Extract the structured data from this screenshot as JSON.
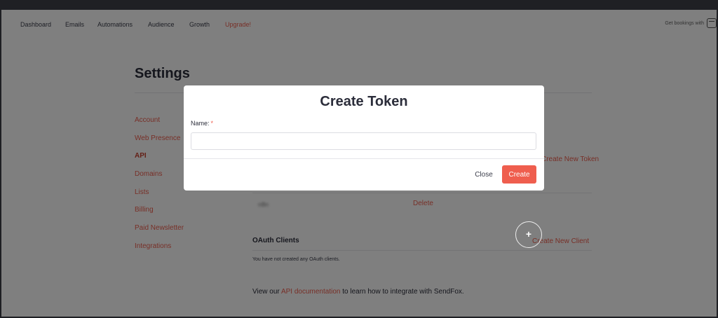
{
  "nav": {
    "items": [
      "Dashboard",
      "Emails",
      "Automations",
      "Audience",
      "Growth"
    ],
    "upgrade": "Upgrade!",
    "bookings": "Get bookings with"
  },
  "page": {
    "title": "Settings"
  },
  "sidebar": {
    "items": [
      "Account",
      "Web Presence",
      "API",
      "Domains",
      "Lists",
      "Billing",
      "Paid Newsletter",
      "Integrations"
    ],
    "active": "API"
  },
  "api": {
    "create_token_link": "Create New Token",
    "token_name": "n8n",
    "delete_link": "Delete",
    "oauth_title": "OAuth Clients",
    "create_client_link": "Create New Client",
    "oauth_empty": "You have not created any OAuth clients.",
    "note_prefix": "View our ",
    "note_link": "API documentation",
    "note_suffix": " to learn how to integrate with SendFox."
  },
  "modal": {
    "title": "Create Token",
    "name_label": "Name:",
    "required_mark": "*",
    "name_value": "",
    "close_label": "Close",
    "create_label": "Create"
  },
  "colors": {
    "accent": "#ef5e4e",
    "text": "#2b2d3a",
    "overlay": "rgba(0,0,0,0.5)"
  }
}
